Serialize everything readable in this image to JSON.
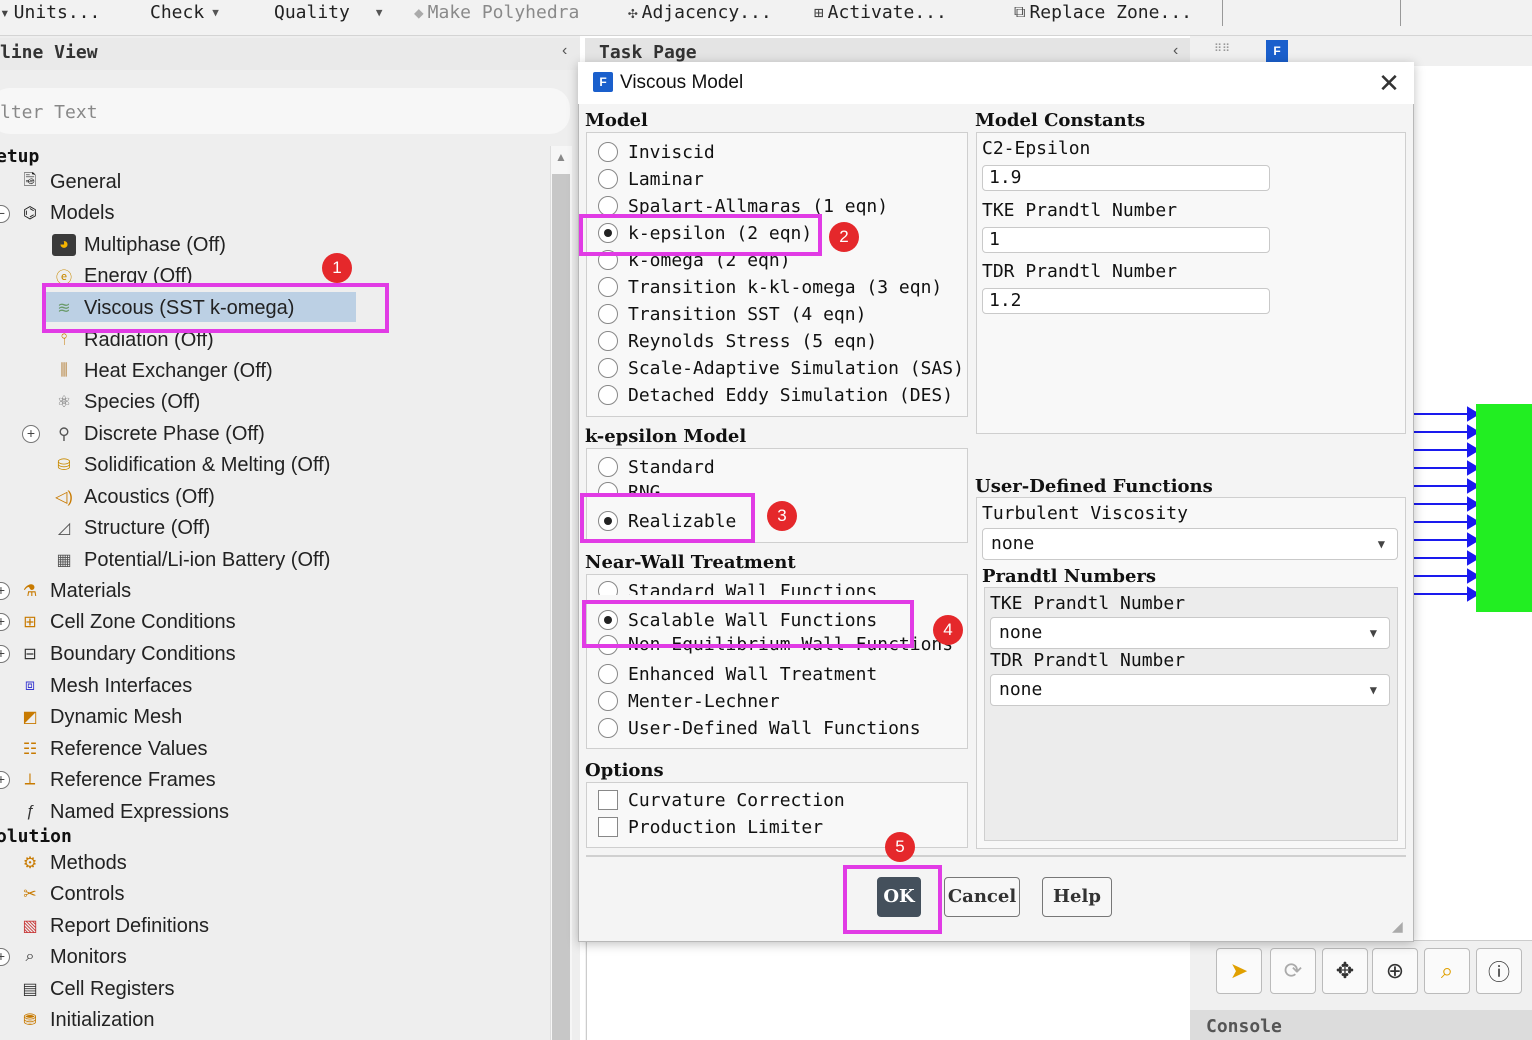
{
  "toolbar": {
    "units": "Units...",
    "check": "Check",
    "quality": "Quality",
    "make_polyhedra": "Make Polyhedra",
    "adjacency": "Adjacency...",
    "activate": "Activate...",
    "replace_zone": "Replace Zone..."
  },
  "outline": {
    "title": "line View",
    "filter_placeholder": "lter Text",
    "setup_label": "etup",
    "solution_label": "olution",
    "setup_items": [
      {
        "label": "General",
        "icon": "general-icon"
      },
      {
        "label": "Models",
        "icon": "models-icon"
      },
      {
        "label": "Multiphase (Off)",
        "icon": "multiphase-icon"
      },
      {
        "label": "Energy (Off)",
        "icon": "energy-icon"
      },
      {
        "label": "Viscous (SST k-omega)",
        "icon": "viscous-icon"
      },
      {
        "label": "Radiation (Off)",
        "icon": "radiation-icon"
      },
      {
        "label": "Heat Exchanger (Off)",
        "icon": "heat-exchanger-icon"
      },
      {
        "label": "Species (Off)",
        "icon": "species-icon"
      },
      {
        "label": "Discrete Phase (Off)",
        "icon": "discrete-phase-icon"
      },
      {
        "label": "Solidification & Melting (Off)",
        "icon": "solidification-icon"
      },
      {
        "label": "Acoustics (Off)",
        "icon": "acoustics-icon"
      },
      {
        "label": "Structure (Off)",
        "icon": "structure-icon"
      },
      {
        "label": "Potential/Li-ion Battery (Off)",
        "icon": "battery-icon"
      },
      {
        "label": "Materials",
        "icon": "materials-icon"
      },
      {
        "label": "Cell Zone Conditions",
        "icon": "cell-zone-icon"
      },
      {
        "label": "Boundary Conditions",
        "icon": "boundary-icon"
      },
      {
        "label": "Mesh Interfaces",
        "icon": "mesh-interfaces-icon"
      },
      {
        "label": "Dynamic Mesh",
        "icon": "dynamic-mesh-icon"
      },
      {
        "label": "Reference Values",
        "icon": "reference-values-icon"
      },
      {
        "label": "Reference Frames",
        "icon": "reference-frames-icon"
      },
      {
        "label": "Named Expressions",
        "icon": "named-expressions-icon"
      }
    ],
    "solution_items": [
      {
        "label": "Methods",
        "icon": "methods-icon"
      },
      {
        "label": "Controls",
        "icon": "controls-icon"
      },
      {
        "label": "Report Definitions",
        "icon": "report-definitions-icon"
      },
      {
        "label": "Monitors",
        "icon": "monitors-icon"
      },
      {
        "label": "Cell Registers",
        "icon": "cell-registers-icon"
      },
      {
        "label": "Initialization",
        "icon": "initialization-icon"
      }
    ]
  },
  "task_page": {
    "title": "Task Page"
  },
  "console": {
    "title": "Console"
  },
  "dialog": {
    "title": "Viscous Model",
    "model": {
      "title": "Model",
      "options": [
        "Inviscid",
        "Laminar",
        "Spalart-Allmaras (1 eqn)",
        "k-epsilon (2 eqn)",
        "k-omega (2 eqn)",
        "Transition k-kl-omega (3 eqn)",
        "Transition SST (4 eqn)",
        "Reynolds Stress (5 eqn)",
        "Scale-Adaptive Simulation (SAS)",
        "Detached Eddy Simulation (DES)"
      ],
      "selected": "k-epsilon (2 eqn)"
    },
    "ke_model": {
      "title": "k-epsilon Model",
      "options": [
        "Standard",
        "RNG",
        "Realizable"
      ],
      "selected": "Realizable"
    },
    "near_wall": {
      "title": "Near-Wall Treatment",
      "options": [
        "Standard Wall Functions",
        "Scalable Wall Functions",
        "Non-Equilibrium Wall Functions",
        "Enhanced Wall Treatment",
        "Menter-Lechner",
        "User-Defined Wall Functions"
      ],
      "selected": "Scalable Wall Functions"
    },
    "options": {
      "title": "Options",
      "items": [
        "Curvature Correction",
        "Production Limiter"
      ]
    },
    "constants": {
      "title": "Model Constants",
      "items": [
        {
          "label": "C2-Epsilon",
          "value": "1.9"
        },
        {
          "label": "TKE Prandtl Number",
          "value": "1"
        },
        {
          "label": "TDR Prandtl Number",
          "value": "1.2"
        }
      ]
    },
    "udf": {
      "title": "User-Defined Functions",
      "turbulent_viscosity_label": "Turbulent Viscosity",
      "turbulent_viscosity_value": "none",
      "prandtl_title": "Prandtl Numbers",
      "tke_label": "TKE Prandtl Number",
      "tke_value": "none",
      "tdr_label": "TDR Prandtl Number",
      "tdr_value": "none"
    },
    "buttons": {
      "ok": "OK",
      "cancel": "Cancel",
      "help": "Help"
    }
  },
  "annotations": [
    "1",
    "2",
    "3",
    "4",
    "5"
  ],
  "colors": {
    "highlight": "#e13be5",
    "badge": "#e5282b",
    "selection": "#bcd0e4",
    "mesh": "#22ee22",
    "vectors": "#1a1aee"
  }
}
